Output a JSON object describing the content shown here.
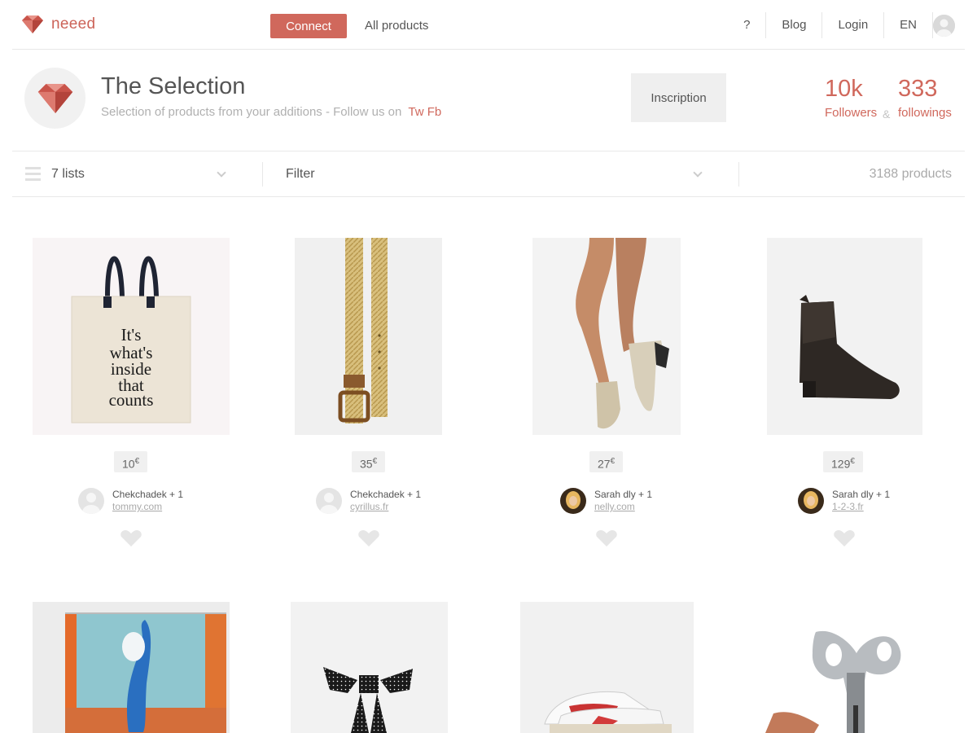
{
  "brand": {
    "name": "neeed",
    "accent": "#d0685c"
  },
  "nav": {
    "connect_label": "Connect",
    "all_products_label": "All products",
    "help_label": "?",
    "blog_label": "Blog",
    "login_label": "Login",
    "lang_label": "EN"
  },
  "profile": {
    "title": "The Selection",
    "subtitle": "Selection of products from your additions - Follow us on",
    "social": "Tw Fb",
    "inscription_label": "Inscription",
    "followers_count": "10k",
    "followers_label": "Followers",
    "amp": "&",
    "followings_count": "333",
    "followings_label": "followings"
  },
  "filterbar": {
    "lists_label": "7 lists",
    "filter_label": "Filter",
    "products_count": "3188 products"
  },
  "products": [
    {
      "price": "10",
      "currency": "€",
      "user": "Chekchadek + 1",
      "site": "tommy.com",
      "image": "tote-bag",
      "avatar": "default"
    },
    {
      "price": "35",
      "currency": "€",
      "user": "Chekchadek + 1",
      "site": "cyrillus.fr",
      "image": "gold-belt",
      "avatar": "default"
    },
    {
      "price": "27",
      "currency": "€",
      "user": "Sarah dly + 1",
      "site": "nelly.com",
      "image": "silver-ankle-boots",
      "avatar": "photo"
    },
    {
      "price": "129",
      "currency": "€",
      "user": "Sarah dly + 1",
      "site": "1-2-3.fr",
      "image": "black-chelsea-boot",
      "avatar": "photo"
    },
    {
      "image": "shower-curtain"
    },
    {
      "image": "polka-dot-bow"
    },
    {
      "image": "sneakers"
    },
    {
      "image": "wind-up-key"
    }
  ],
  "tote_text": [
    "It's",
    "what's",
    "inside",
    "that",
    "counts"
  ]
}
